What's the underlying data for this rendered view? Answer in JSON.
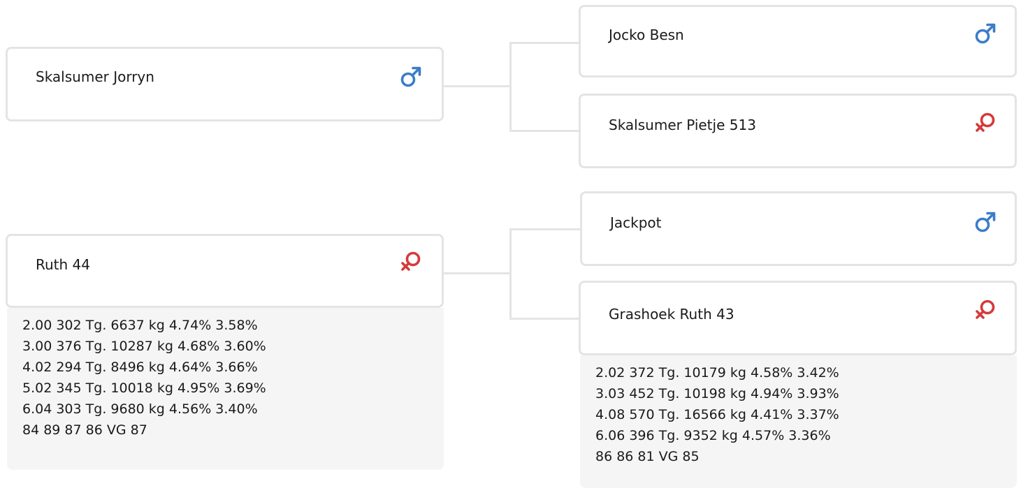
{
  "animals": {
    "sire": {
      "name": "Skalsumer Jorryn",
      "sex": "male-icon"
    },
    "sire_sire": {
      "name": "Jocko Besn",
      "sex": "male-icon"
    },
    "sire_dam": {
      "name": "Skalsumer Pietje 513",
      "sex": "female-icon"
    },
    "dam": {
      "name": "Ruth 44",
      "sex": "female-icon",
      "stats": [
        "2.00 302 Tg. 6637 kg 4.74% 3.58%",
        "3.00 376 Tg. 10287 kg 4.68% 3.60%",
        "4.02 294 Tg. 8496 kg 4.64% 3.66%",
        "5.02 345 Tg. 10018 kg 4.95% 3.69%",
        "6.04 303 Tg. 9680 kg 4.56% 3.40%",
        "84 89 87 86 VG 87"
      ]
    },
    "dam_sire": {
      "name": "Jackpot",
      "sex": "male-icon"
    },
    "dam_dam": {
      "name": "Grashoek Ruth 43",
      "sex": "female-icon",
      "stats": [
        "2.02 372 Tg. 10179 kg 4.58% 3.42%",
        "3.03 452 Tg. 10198 kg 4.94% 3.93%",
        "4.08 570 Tg. 16566 kg 4.41% 3.37%",
        "6.06 396 Tg. 9352 kg 4.57% 3.36%",
        "86 86 81 VG 85"
      ]
    }
  },
  "colors": {
    "male": "#3b7dc8",
    "female": "#d53a3a",
    "border": "#e4e4e4",
    "stats_bg": "#f5f5f5"
  }
}
